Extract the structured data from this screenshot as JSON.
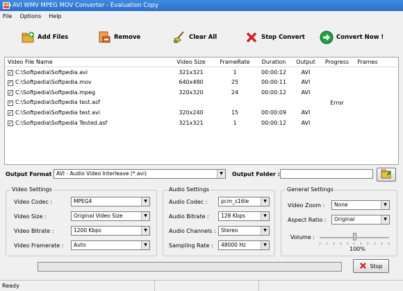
{
  "window": {
    "title": "AVI WMV MPEG MOV Converter - Evaluation Copy",
    "app_icon": "CAB"
  },
  "menu": [
    "File",
    "Options",
    "Help"
  ],
  "toolbar": {
    "add": "Add Files",
    "remove": "Remove",
    "clear": "Clear All",
    "stop": "Stop Convert",
    "convert": "Convert Now !"
  },
  "table": {
    "headers": [
      "Video File Name",
      "Video Size",
      "FrameRate",
      "Duration",
      "Output",
      "Progress",
      "Frames"
    ],
    "rows": [
      {
        "name": "C:\\Softpedia\\Softpedia.avi",
        "size": "321x321",
        "fr": "1",
        "dur": "00:00:12",
        "out": "AVI",
        "prog": "",
        "frames": ""
      },
      {
        "name": "C:\\Softpedia\\Softpedia.mov",
        "size": "640x480",
        "fr": "25",
        "dur": "00:00:11",
        "out": "AVI",
        "prog": "",
        "frames": ""
      },
      {
        "name": "C:\\Softpedia\\Softpedia.mpeg",
        "size": "320x320",
        "fr": "24",
        "dur": "00:00:12",
        "out": "AVI",
        "prog": "",
        "frames": ""
      },
      {
        "name": "C:\\Softpedia\\Softpedia test.asf",
        "size": "",
        "fr": "",
        "dur": "",
        "out": "",
        "prog": "Error",
        "frames": ""
      },
      {
        "name": "C:\\Softpedia\\Softpedia test.avi",
        "size": "320x240",
        "fr": "15",
        "dur": "00:00:09",
        "out": "AVI",
        "prog": "",
        "frames": ""
      },
      {
        "name": "C:\\Softpedia\\Softpedia Tested.asf",
        "size": "321x321",
        "fr": "1",
        "dur": "00:00:12",
        "out": "AVI",
        "prog": "",
        "frames": ""
      }
    ]
  },
  "output": {
    "format_label": "Output Format :",
    "format_value": "AVI - Audio Video Interleave (*.avi)",
    "folder_label": "Output Folder :",
    "folder_value": ""
  },
  "video": {
    "title": "Video Settings",
    "codec_label": "Video Codec :",
    "codec": "MPEG4",
    "size_label": "Video Size :",
    "size": "Original Video Size",
    "bitrate_label": "Video Bitrate :",
    "bitrate": "1200 Kbps",
    "framerate_label": "Video Framerate :",
    "framerate": "Auto"
  },
  "audio": {
    "title": "Audio Settings",
    "codec_label": "Audio Codec :",
    "codec": "pcm_s16le",
    "bitrate_label": "Audio Bitrate :",
    "bitrate": "128 Kbps",
    "channels_label": "Audio Channels :",
    "channels": "Stereo",
    "rate_label": "Sampling Rate :",
    "rate": "48000 Hz"
  },
  "general": {
    "title": "General Settings",
    "zoom_label": "Video Zoom :",
    "zoom": "None",
    "aspect_label": "Aspect Ratio :",
    "aspect": "Original",
    "volume_label": "Volume :",
    "volume": "100%",
    "volume_level": 0.5
  },
  "controls": {
    "stop": "Stop",
    "progress": 0
  },
  "status": {
    "text": "Ready"
  },
  "colors": {
    "titlebar": "#2d6fc8",
    "add_icon": "#e8a020",
    "remove_icon": "#e07030",
    "stop_icon": "#d02020",
    "convert_icon": "#20a040"
  }
}
